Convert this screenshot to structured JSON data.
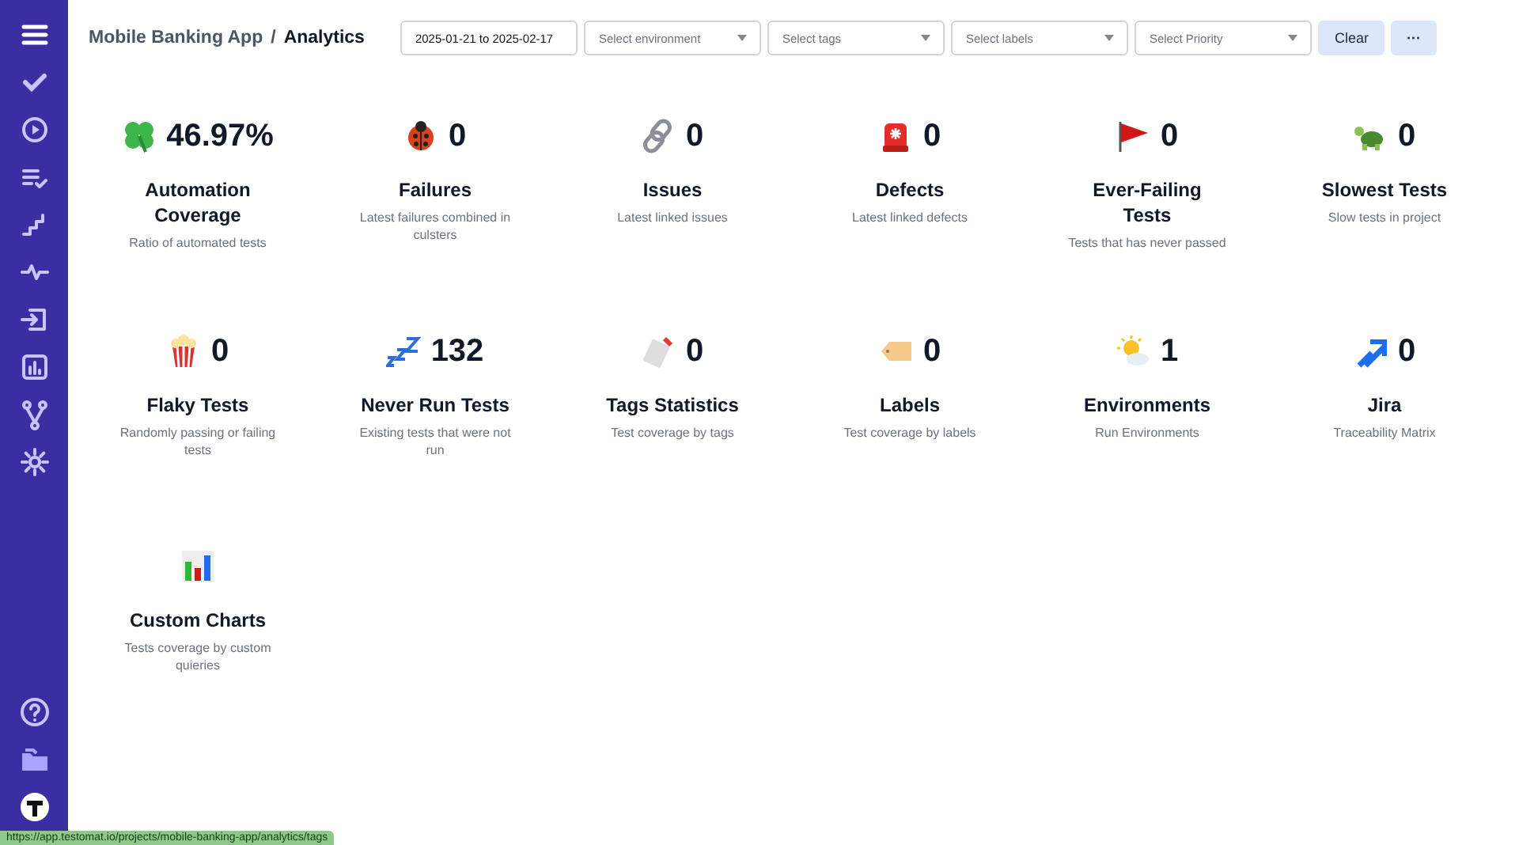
{
  "breadcrumb": {
    "project": "Mobile Banking App",
    "separator": "/",
    "page": "Analytics"
  },
  "filters": [
    {
      "kind": "date",
      "value": "2025-01-21 to 2025-02-17"
    },
    {
      "kind": "select",
      "placeholder": "Select environment"
    },
    {
      "kind": "select",
      "placeholder": "Select tags"
    },
    {
      "kind": "select",
      "placeholder": "Select labels"
    },
    {
      "kind": "select",
      "placeholder": "Select Priority"
    }
  ],
  "buttons": [
    {
      "kind": "text",
      "label": "Clear"
    },
    {
      "kind": "more",
      "label": "···"
    }
  ],
  "cards": [
    {
      "value": "46.97%",
      "title": "Automation Coverage",
      "description": "Ratio of automated tests"
    },
    {
      "value": "0",
      "title": "Failures",
      "description": "Latest failures combined in culsters"
    },
    {
      "value": "0",
      "title": "Issues",
      "description": "Latest linked issues"
    },
    {
      "value": "0",
      "title": "Defects",
      "description": "Latest linked defects"
    },
    {
      "value": "0",
      "title": "Ever-Failing Tests",
      "description": "Tests that has never passed"
    },
    {
      "value": "0",
      "title": "Slowest Tests",
      "description": "Slow tests in project"
    },
    {
      "value": "0",
      "title": "Flaky Tests",
      "description": "Randomly passing or failing tests"
    },
    {
      "value": "132",
      "title": "Never Run Tests",
      "description": "Existing tests that were not run"
    },
    {
      "value": "0",
      "title": "Tags Statistics",
      "description": "Test coverage by tags"
    },
    {
      "value": "0",
      "title": "Labels",
      "description": "Test coverage by labels"
    },
    {
      "value": "1",
      "title": "Environments",
      "description": "Run Environments"
    },
    {
      "value": "0",
      "title": "Jira",
      "description": "Traceability Matrix"
    },
    {
      "title": "Custom Charts",
      "description": "Tests coverage by custom quieries"
    }
  ],
  "status_bar": {
    "url": "https://app.testomat.io/projects/mobile-banking-app/analytics/tags"
  }
}
